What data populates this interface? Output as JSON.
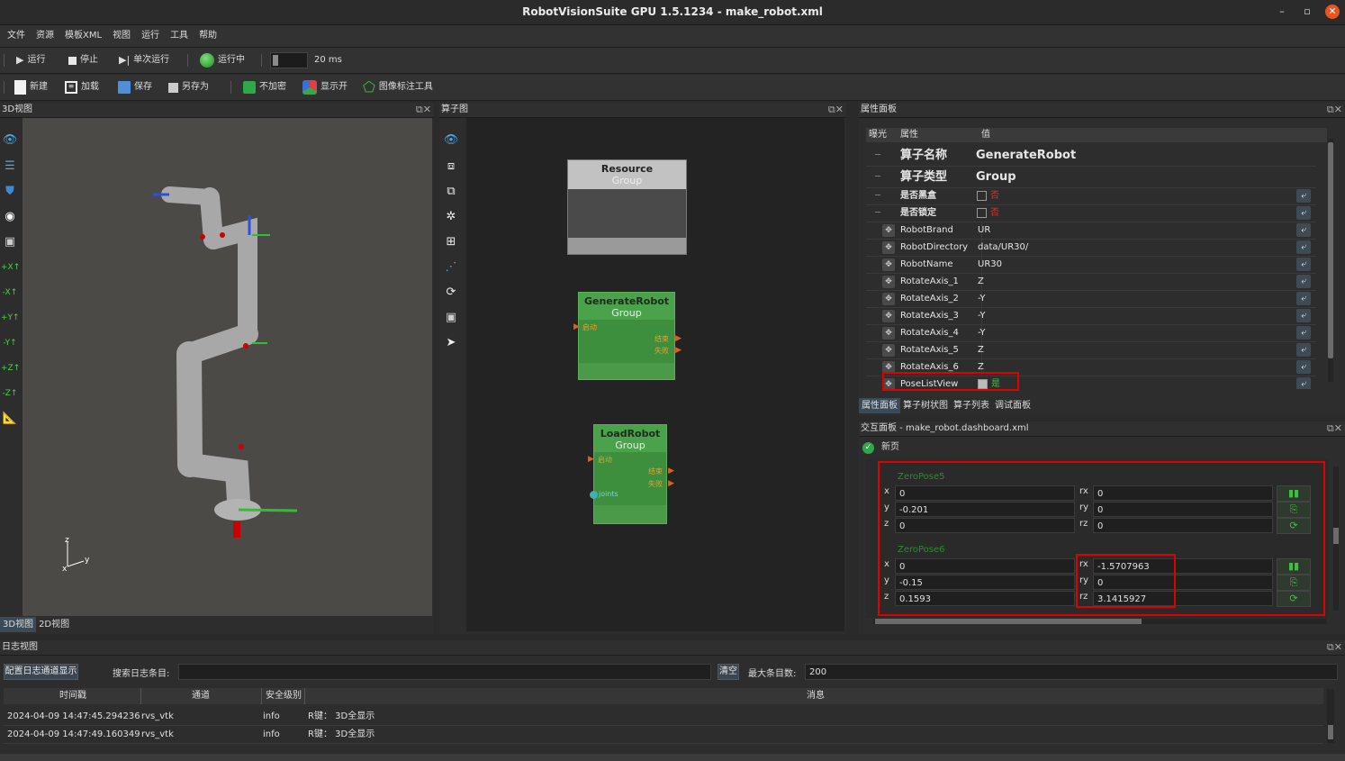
{
  "window": {
    "title": "RobotVisionSuite GPU 1.5.1234 - make_robot.xml",
    "min": "–",
    "max": "▫",
    "close": "✕"
  },
  "menu": [
    "文件",
    "资源",
    "模板XML",
    "视图",
    "运行",
    "工具",
    "帮助"
  ],
  "run_toolbar": {
    "run": "运行",
    "stop": "停止",
    "single": "单次运行",
    "running": "运行中",
    "interval": "20 ms"
  },
  "file_toolbar": {
    "new": "新建",
    "load": "加载",
    "save": "保存",
    "save_as": "另存为",
    "no_encrypt": "不加密",
    "display_on": "显示开",
    "annotate": "图像标注工具"
  },
  "view3d": {
    "title": "3D视图",
    "axis": {
      "z": "z",
      "x": "x",
      "y": "y"
    },
    "tabs": [
      "3D视图",
      "2D视图"
    ],
    "tools": [
      "eye-icon",
      "list-icon",
      "shield-icon",
      "target-icon",
      "camera-icon",
      "plus-x-icon",
      "minus-x-icon",
      "plus-y-icon",
      "minus-y-icon",
      "plus-z-icon",
      "minus-z-icon",
      "ruler-icon"
    ]
  },
  "operator_graph": {
    "title": "算子图",
    "nodes": [
      {
        "title": "Resource",
        "subtitle": "Group"
      },
      {
        "title": "GenerateRobot",
        "subtitle": "Group",
        "in": "启动",
        "out1": "结束",
        "out2": "失败"
      },
      {
        "title": "LoadRobot",
        "subtitle": "Group",
        "in": "启动",
        "out1": "结束",
        "out2": "失败",
        "extra": "joints"
      }
    ]
  },
  "properties": {
    "title": "属性面板",
    "columns": [
      "曝光",
      "属性",
      "值"
    ],
    "header_rows": [
      {
        "name": "算子名称",
        "value": "GenerateRobot"
      },
      {
        "name": "算子类型",
        "value": "Group"
      }
    ],
    "bool_rows": [
      {
        "name": "是否黑盒",
        "value": "否"
      },
      {
        "name": "是否锁定",
        "value": "否"
      }
    ],
    "rows": [
      {
        "name": "RobotBrand",
        "value": "UR"
      },
      {
        "name": "RobotDirectory",
        "value": "data/UR30/"
      },
      {
        "name": "RobotName",
        "value": "UR30"
      },
      {
        "name": "RotateAxis_1",
        "value": "Z"
      },
      {
        "name": "RotateAxis_2",
        "value": "-Y"
      },
      {
        "name": "RotateAxis_3",
        "value": "-Y"
      },
      {
        "name": "RotateAxis_4",
        "value": "-Y"
      },
      {
        "name": "RotateAxis_5",
        "value": "Z"
      },
      {
        "name": "RotateAxis_6",
        "value": "Z"
      }
    ],
    "pose_row": {
      "name": "PoseListView",
      "value": "是"
    },
    "tabs": [
      "属性面板",
      "算子树状图",
      "算子列表",
      "调试面板"
    ]
  },
  "dashboard": {
    "title": "交互面板 - make_robot.dashboard.xml",
    "page_tab": "新页",
    "poses": [
      {
        "label": "ZeroPose5",
        "x": "0",
        "y": "-0.201",
        "z": "0",
        "rx": "0",
        "ry": "0",
        "rz": "0"
      },
      {
        "label": "ZeroPose6",
        "x": "0",
        "y": "-0.15",
        "z": "0.1593",
        "rx": "-1.5707963",
        "ry": "0",
        "rz": "3.1415927"
      }
    ],
    "labels": {
      "x": "x",
      "y": "y",
      "z": "z",
      "rx": "rx",
      "ry": "ry",
      "rz": "rz"
    }
  },
  "log": {
    "title": "日志视图",
    "config_btn": "配置日志通道显示",
    "search_label": "搜索日志条目:",
    "search_value": "",
    "clear_btn": "清空",
    "max_label": "最大条目数:",
    "max_value": "200",
    "columns": [
      "时间戳",
      "通道",
      "安全级别",
      "消息"
    ],
    "rows": [
      {
        "time": "2024-04-09 14:47:45.294236",
        "channel": "rvs_vtk",
        "level": "info",
        "msg": "R键： 3D全显示"
      },
      {
        "time": "2024-04-09 14:47:49.160349",
        "channel": "rvs_vtk",
        "level": "info",
        "msg": "R键： 3D全显示"
      }
    ]
  },
  "colors": {
    "accent_green": "#3d9a3d",
    "highlight_red": "#e00000",
    "node_gray": "#8a8a8a"
  }
}
